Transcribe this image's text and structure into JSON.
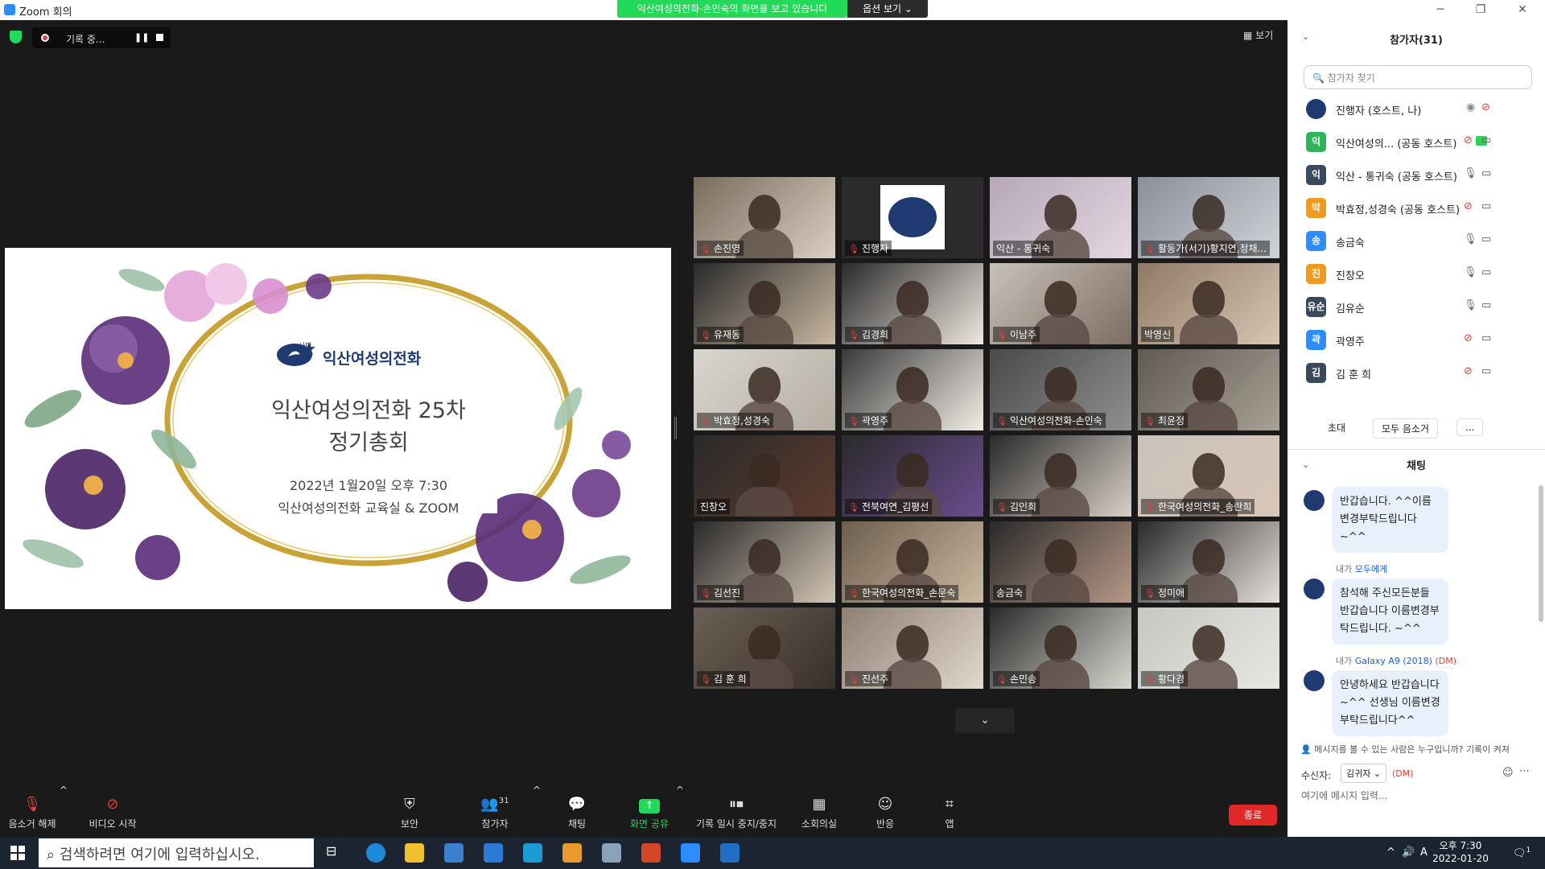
{
  "window": {
    "title": "Zoom 회의",
    "share_banner": "익산여성의전화-손인숙의 화면을 보고 있습니다",
    "share_options": "옵션 보기 ⌄",
    "min": "─",
    "restore": "❐",
    "close": "✕"
  },
  "meeting": {
    "recording_label": "기록 중...",
    "view_label": "보기",
    "more_arrow": "⌄"
  },
  "slide": {
    "logo_small": "사단 법인",
    "logo_text": "익산여성의전화",
    "title_line1": "익산여성의전화 25차",
    "title_line2": "정기총회",
    "date": "2022년 1월20일 오후 7:30",
    "place": "익산여성의전화 교육실 & ZOOM"
  },
  "tiles": [
    {
      "name": "손진영",
      "muted": true
    },
    {
      "name": "진행자",
      "muted": true
    },
    {
      "name": "익산 - 통귀숙",
      "muted": false
    },
    {
      "name": "활동가(서기)황지연,정채...",
      "muted": true
    },
    {
      "name": "유재동",
      "muted": true
    },
    {
      "name": "김경희",
      "muted": true
    },
    {
      "name": "이남주",
      "muted": true
    },
    {
      "name": "박영신",
      "muted": false
    },
    {
      "name": "박효정,성경숙",
      "muted": true
    },
    {
      "name": "곽영주",
      "muted": true
    },
    {
      "name": "익산여성의전화-손인숙",
      "muted": true
    },
    {
      "name": "최윤정",
      "muted": true
    },
    {
      "name": "진창오",
      "muted": false
    },
    {
      "name": "전북여연_김평선",
      "muted": true
    },
    {
      "name": "김인희",
      "muted": true
    },
    {
      "name": "한국여성의전화_송란희",
      "muted": true
    },
    {
      "name": "김선진",
      "muted": true
    },
    {
      "name": "한국여성의전화_손문숙",
      "muted": true
    },
    {
      "name": "송금숙",
      "muted": false
    },
    {
      "name": "정미애",
      "muted": true
    },
    {
      "name": "김 훈 희",
      "muted": true
    },
    {
      "name": "진선주",
      "muted": true
    },
    {
      "name": "손민송",
      "muted": true
    },
    {
      "name": "황다경",
      "muted": true
    }
  ],
  "toolbar": {
    "unmute": "음소거 해제",
    "start_video": "비디오 시작",
    "security": "보안",
    "participants": "참가자",
    "participant_count": "31",
    "chat": "채팅",
    "share": "화면 공유",
    "record": "기록 일시 중지/중지",
    "breakout": "소회의실",
    "reactions": "반응",
    "apps": "앱",
    "end": "종료"
  },
  "panel": {
    "participants_title": "참가자(31)",
    "search_placeholder": "🔍 참가자 찾기",
    "participants": [
      {
        "initial": "",
        "name": "진행자 (호스트, 나)",
        "color": "#1f3a70"
      },
      {
        "initial": "익",
        "name": "익산여성의...   (공동 호스트)",
        "color": "#2fb45a"
      },
      {
        "initial": "익",
        "name": "익산 - 통귀숙 (공동 호스트)",
        "color": "#3a4a5e"
      },
      {
        "initial": "박",
        "name": "박효정,성경숙 (공동 호스트)",
        "color": "#f29a1e"
      },
      {
        "initial": "송",
        "name": "송금숙",
        "color": "#2d8cff"
      },
      {
        "initial": "진",
        "name": "진창오",
        "color": "#f29a1e"
      },
      {
        "initial": "유순",
        "name": "김유순",
        "color": "#3a4a5e"
      },
      {
        "initial": "곽",
        "name": "곽영주",
        "color": "#2d8cff"
      },
      {
        "initial": "김",
        "name": "김 훈 희",
        "color": "#3a4a5e"
      }
    ],
    "invite": "초대",
    "mute_all": "모두 음소거",
    "more": "...",
    "chat_title": "채팅",
    "messages": [
      {
        "meta": "",
        "to": "",
        "dm": "",
        "text": "반갑습니다. ^^이름변경부탁드립니다~^^"
      },
      {
        "meta": "내가",
        "to": "모두에게",
        "dm": "",
        "text": "참석해 주신모든분들 반갑습니다 이름변경부탁드립니다. ~^^"
      },
      {
        "meta": "내가",
        "to": "Galaxy A9 (2018)",
        "dm": "(DM)",
        "text": "안녕하세요 반갑습니다 ~^^ 선생님 이름변경부탁드립니다^^"
      }
    ],
    "visibility_note": "메시지를 볼 수 있는 사람은 누구입니까? 기록이 켜져",
    "recipient_label": "수신자:",
    "recipient": "김귀자 ⌄",
    "recipient_dm": "(DM)",
    "input_placeholder": "여기에 메시지 입력..."
  },
  "taskbar": {
    "search": "검색하려면 여기에 입력하십시오.",
    "time": "오후 7:30",
    "date": "2022-01-20",
    "ime": "A",
    "notif": "1"
  }
}
